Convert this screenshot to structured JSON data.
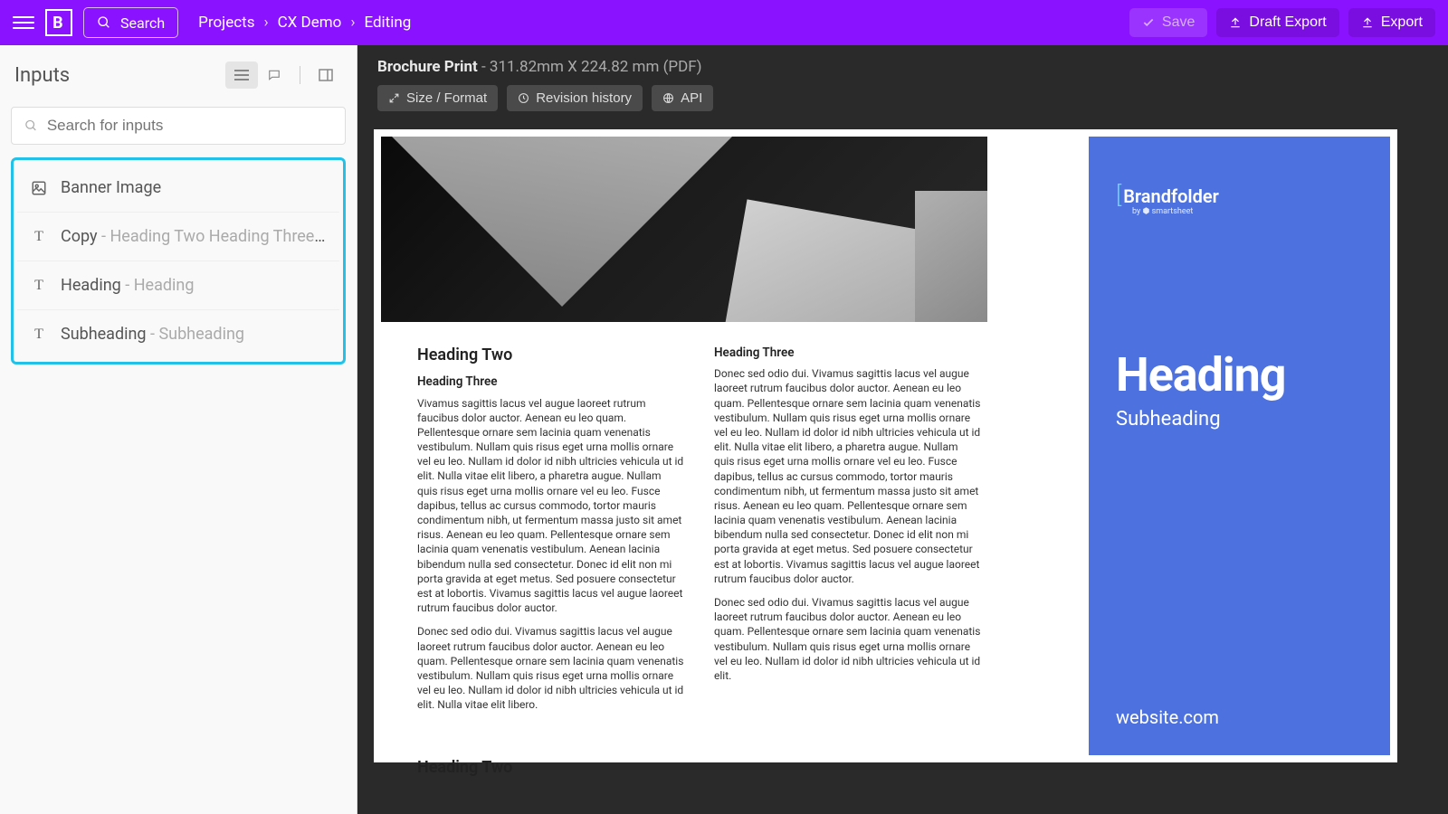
{
  "topbar": {
    "search": "Search",
    "breadcrumb": [
      "Projects",
      "CX Demo",
      "Editing"
    ],
    "save": "Save",
    "draft_export": "Draft Export",
    "export": "Export"
  },
  "sidebar": {
    "title": "Inputs",
    "search_placeholder": "Search for inputs",
    "items": [
      {
        "label": "Banner Image",
        "preview": "",
        "type": "image"
      },
      {
        "label": "Copy",
        "preview": "Heading Two Heading Three Viv...",
        "type": "text"
      },
      {
        "label": "Heading",
        "preview": "Heading",
        "type": "text"
      },
      {
        "label": "Subheading",
        "preview": "Subheading",
        "type": "text"
      }
    ]
  },
  "doc": {
    "name": "Brochure Print",
    "meta": " - 311.82mm X 224.82 mm (PDF)",
    "size_format": "Size / Format",
    "revision": "Revision history",
    "api": "API"
  },
  "brochure": {
    "col1": {
      "h2": "Heading Two",
      "h3": "Heading Three",
      "p1": "Vivamus sagittis lacus vel augue laoreet rutrum faucibus dolor auctor. Aenean eu leo quam. Pellentesque ornare sem lacinia quam venenatis vestibulum. Nullam quis risus eget urna mollis ornare vel eu leo. Nullam id dolor id nibh ultricies vehicula ut id elit. Nulla vitae elit libero, a pharetra augue. Nullam quis risus eget urna mollis ornare vel eu leo. Fusce dapibus, tellus ac cursus commodo, tortor mauris condimentum nibh, ut fermentum massa justo sit amet risus. Aenean eu leo quam. Pellentesque ornare sem lacinia quam venenatis vestibulum. Aenean lacinia bibendum nulla sed consectetur. Donec id elit non mi porta gravida at eget metus. Sed posuere consectetur est at lobortis. Vivamus sagittis lacus vel augue laoreet rutrum faucibus dolor auctor.",
      "p2": "Donec sed odio dui. Vivamus sagittis lacus vel augue laoreet rutrum faucibus dolor auctor. Aenean eu leo quam. Pellentesque ornare sem lacinia quam venenatis vestibulum. Nullam quis risus eget urna mollis ornare vel eu leo. Nullam id dolor id nibh ultricies vehicula ut id elit. Nulla vitae elit libero.",
      "h2b": "Heading Two"
    },
    "col2": {
      "h3": "Heading Three",
      "p1": "Donec sed odio dui. Vivamus sagittis lacus vel augue laoreet rutrum faucibus dolor auctor. Aenean eu leo quam. Pellentesque ornare sem lacinia quam venenatis vestibulum. Nullam quis risus eget urna mollis ornare vel eu leo. Nullam id dolor id nibh ultricies vehicula ut id elit. Nulla vitae elit libero, a pharetra augue. Nullam quis risus eget urna mollis ornare vel eu leo. Fusce dapibus, tellus ac cursus commodo, tortor mauris condimentum nibh, ut fermentum massa justo sit amet risus. Aenean eu leo quam. Pellentesque ornare sem lacinia quam venenatis vestibulum. Aenean lacinia bibendum nulla sed consectetur. Donec id elit non mi porta gravida at eget metus. Sed posuere consectetur est at lobortis. Vivamus sagittis lacus vel augue laoreet rutrum faucibus dolor auctor.",
      "p2": "Donec sed odio dui. Vivamus sagittis lacus vel augue laoreet rutrum faucibus dolor auctor. Aenean eu leo quam. Pellentesque ornare sem lacinia quam venenatis vestibulum. Nullam quis risus eget urna mollis ornare vel eu leo. Nullam id dolor id nibh ultricies vehicula ut id elit."
    },
    "panel": {
      "brand": "Brandfolder",
      "brand_sub": "by ⬢ smartsheet",
      "heading": "Heading",
      "subheading": "Subheading",
      "website": "website.com"
    }
  }
}
